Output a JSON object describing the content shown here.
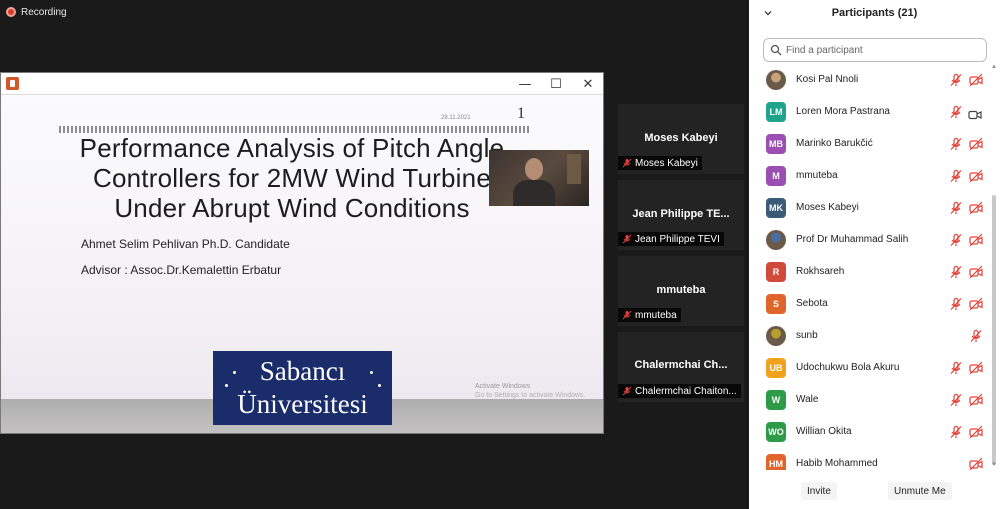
{
  "recording": {
    "label": "Recording"
  },
  "presentation": {
    "window": {
      "minimize": "—",
      "maximize": "☐",
      "close": "✕"
    },
    "date": "28.11.2021",
    "slide_number": "1",
    "title_lines": [
      "Performance Analysis of Pitch Angle",
      "Controllers for 2MW Wind Turbine",
      "Under Abrupt Wind Conditions"
    ],
    "author": "Ahmet Selim Pehlivan Ph.D. Candidate",
    "advisor": "Advisor : Assoc.Dr.Kemalettin Erbatur",
    "logo_lines": [
      "Sabancı",
      "Üniversitesi"
    ],
    "watermark_lines": [
      "Activate Windows",
      "Go to Settings to activate Windows."
    ]
  },
  "video_tiles": [
    {
      "name": "Moses Kabeyi",
      "label": "Moses Kabeyi"
    },
    {
      "name": "Jean Philippe TE...",
      "label": "Jean Philippe TEVI"
    },
    {
      "name": "mmuteba",
      "label": "mmuteba"
    },
    {
      "name": "Chalermchai Ch...",
      "label": "Chalermchai Chaiton..."
    }
  ],
  "participants_panel": {
    "title": "Participants (21)",
    "search_placeholder": "Find a participant",
    "participants": [
      {
        "initials": "",
        "name": "Kosi Pal Nnoli",
        "avatar_color": "#c9a27c",
        "photo": true,
        "mic_muted": true,
        "video": "off"
      },
      {
        "initials": "LM",
        "name": "Loren Mora Pastrana",
        "avatar_color": "#1fa38a",
        "photo": false,
        "mic_muted": true,
        "video": "on"
      },
      {
        "initials": "MB",
        "name": "Marinko Barukčić",
        "avatar_color": "#9b4fb3",
        "photo": false,
        "mic_muted": true,
        "video": "off"
      },
      {
        "initials": "M",
        "name": "mmuteba",
        "avatar_color": "#9b4fb3",
        "photo": false,
        "mic_muted": true,
        "video": "off"
      },
      {
        "initials": "MK",
        "name": "Moses Kabeyi",
        "avatar_color": "#3b5a78",
        "photo": false,
        "mic_muted": true,
        "video": "off"
      },
      {
        "initials": "",
        "name": "Prof Dr Muhammad Salih",
        "avatar_color": "#4a6fa5",
        "photo": true,
        "mic_muted": true,
        "video": "off"
      },
      {
        "initials": "R",
        "name": "Rokhsareh",
        "avatar_color": "#d14b3a",
        "photo": false,
        "mic_muted": true,
        "video": "off"
      },
      {
        "initials": "S",
        "name": "Sebota",
        "avatar_color": "#e0652b",
        "photo": false,
        "mic_muted": true,
        "video": "off"
      },
      {
        "initials": "",
        "name": "sunb",
        "avatar_color": "#b6a02a",
        "photo": true,
        "mic_muted": true,
        "video": "none"
      },
      {
        "initials": "UB",
        "name": "Udochukwu Bola Akuru",
        "avatar_color": "#f0a21f",
        "photo": false,
        "mic_muted": true,
        "video": "off"
      },
      {
        "initials": "W",
        "name": "Wale",
        "avatar_color": "#2e9b48",
        "photo": false,
        "mic_muted": true,
        "video": "off"
      },
      {
        "initials": "WO",
        "name": "Willian Okita",
        "avatar_color": "#2e9b48",
        "photo": false,
        "mic_muted": true,
        "video": "off"
      },
      {
        "initials": "HM",
        "name": "Habib Mohammed",
        "avatar_color": "#e0652b",
        "photo": false,
        "mic_muted": false,
        "video": "off"
      }
    ],
    "invite_label": "Invite",
    "unmute_label": "Unmute Me"
  },
  "colors": {
    "muted_red": "#e0433a",
    "panel_bg": "#ffffff",
    "meeting_bg": "#1a1a1a"
  }
}
